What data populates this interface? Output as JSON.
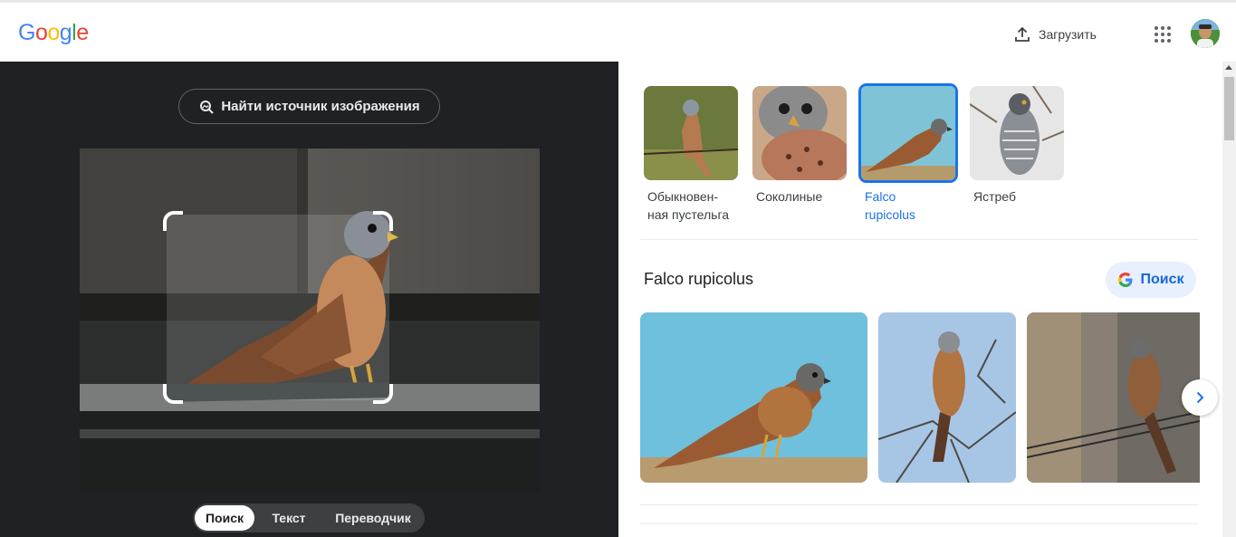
{
  "header": {
    "logo_letters": [
      {
        "char": "G",
        "color": "#4285F4"
      },
      {
        "char": "o",
        "color": "#EA4335"
      },
      {
        "char": "o",
        "color": "#FBBC05"
      },
      {
        "char": "g",
        "color": "#4285F4"
      },
      {
        "char": "l",
        "color": "#34A853"
      },
      {
        "char": "e",
        "color": "#EA4335"
      }
    ],
    "upload_label": "Загрузить",
    "upload_icon": "upload-icon",
    "apps_icon": "apps-grid-icon",
    "avatar_icon": "account-avatar"
  },
  "left": {
    "find_source_label": "Найти источник изображения",
    "find_source_icon": "image-search-icon",
    "modes": [
      {
        "label": "Поиск",
        "active": true
      },
      {
        "label": "Текст",
        "active": false
      },
      {
        "label": "Переводчик",
        "active": false
      }
    ]
  },
  "right": {
    "chips": [
      {
        "label": "Обыкновен-\nная пустельга",
        "selected": false
      },
      {
        "label": "Соколиные",
        "selected": false
      },
      {
        "label": "Falco\nrupicolus",
        "selected": true
      },
      {
        "label": "Ястреб",
        "selected": false
      }
    ],
    "result_title": "Falco rupicolus",
    "search_button_label": "Поиск",
    "next_icon": "chevron-right-icon"
  },
  "colors": {
    "accent": "#1a73e8",
    "dark_panel": "#202124",
    "pill_bg": "#e8f0fe"
  }
}
